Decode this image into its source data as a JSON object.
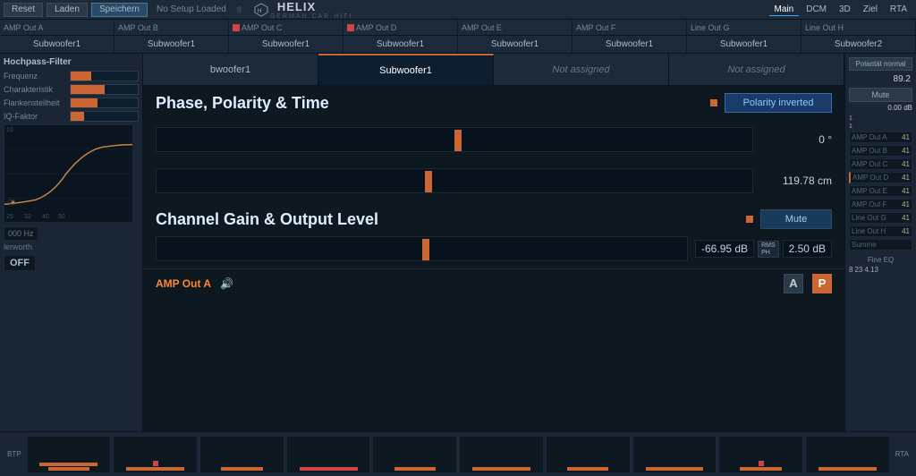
{
  "topbar": {
    "buttons": [
      "Reset",
      "Laden",
      "Speichern"
    ],
    "noSetup": "No Setup Loaded",
    "logo": "HELIX",
    "logoSub": "GERMAN CAR HIFI",
    "nav": [
      "Main",
      "DCM",
      "3D",
      "Ziel",
      "RTA"
    ]
  },
  "channelStrip": {
    "channels": [
      {
        "label": "AMP Out A",
        "hasIndicator": false
      },
      {
        "label": "AMP Out B",
        "hasIndicator": false
      },
      {
        "label": "AMP Out C",
        "hasIndicator": true
      },
      {
        "label": "AMP Out D",
        "hasIndicator": true
      },
      {
        "label": "AMP Out E",
        "hasIndicator": false
      },
      {
        "label": "AMP Out F",
        "hasIndicator": false
      },
      {
        "label": "Line Out G",
        "hasIndicator": false
      },
      {
        "label": "Line Out H",
        "hasIndicator": false
      }
    ]
  },
  "tabs": [
    {
      "label": "bwoofer1",
      "active": false
    },
    {
      "label": "Subwoofer1",
      "active": true
    },
    {
      "label": "Not assigned",
      "active": false,
      "unassigned": true
    },
    {
      "label": "Not assigned",
      "active": false,
      "unassigned": true
    }
  ],
  "leftPanel": {
    "sectionTitle": "Hochpass-Filter",
    "params": [
      {
        "label": "Frequenz",
        "value": 0.3
      },
      {
        "label": "Charakteristik",
        "value": 0.5
      },
      {
        "label": "Flankensteilheit",
        "value": 0.4
      },
      {
        "label": "IQ-Faktor",
        "value": 0.2
      }
    ],
    "filterType": "000 Hz",
    "filterTypeLabel": "lerworth",
    "offLabel": "OFF",
    "axisLabels": [
      "25",
      "32",
      "40",
      "50"
    ]
  },
  "phaseSection": {
    "title": "Phase, Polarity & Time",
    "polarityBtn": "Polarity inverted",
    "phaseValue": "0 °",
    "timeValue": "119.78 cm",
    "phaseSliderPos": 0.5,
    "timeSliderPos": 0.45
  },
  "gainSection": {
    "title": "Channel Gain & Output Level",
    "muteBtn": "Mute",
    "gainDb": "-66.95 dB",
    "rmsLabel": "RMS",
    "phLabel": "PH",
    "outputDb": "2.50 dB",
    "sliderPos": 0.5,
    "orangeDotLabel": ""
  },
  "ampOutBar": {
    "label": "AMP Out A",
    "aBtn": "A",
    "pBtn": "P"
  },
  "rightPanel": {
    "polarityBtn": "Polarität normal",
    "valueTop": "89.2",
    "muteBtn": "Mute",
    "dbValue": "0.00 dB",
    "items": [
      {
        "label": "AMP Out A",
        "val": "41"
      },
      {
        "label": "AMP Out B",
        "val": "41"
      },
      {
        "label": "AMP Out C",
        "val": "41"
      },
      {
        "label": "AMP Out D",
        "val": "41"
      },
      {
        "label": "AMP Out E",
        "val": "41"
      },
      {
        "label": "AMP Out F",
        "val": "41"
      },
      {
        "label": "Line Out G",
        "val": "41"
      },
      {
        "label": "Line Out H",
        "val": "41"
      },
      {
        "label": "Summe",
        "val": ""
      }
    ],
    "fineEq": "Fine EQ",
    "fineEqVals": [
      "8",
      "23",
      "4.13"
    ]
  },
  "bottomBar": {
    "rtaLabel": "RTA",
    "btpLabel": "BTP"
  }
}
